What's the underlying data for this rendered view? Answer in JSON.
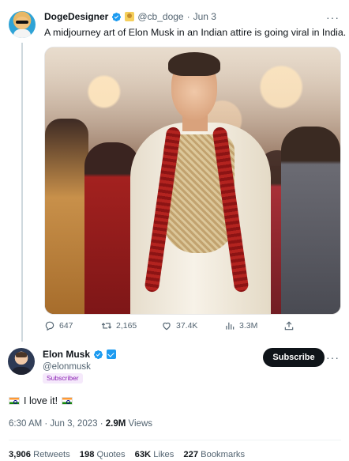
{
  "retweeted_tweet": {
    "author": {
      "display_name": "DogeDesigner",
      "handle": "@cb_doge",
      "verified": true,
      "affiliate_badge": "doge-badge"
    },
    "date": "Jun 3",
    "separator": "·",
    "more": "···",
    "text": "A midjourney art of Elon Musk in an Indian attire is going viral in India.",
    "text_emoji": "india-flag",
    "image_alt": "Elon Musk in Indian wedding attire",
    "actions": {
      "replies": "647",
      "retweets": "2,165",
      "likes": "37.4K",
      "views": "3.3M"
    }
  },
  "main_tweet": {
    "author": {
      "display_name": "Elon Musk",
      "handle": "@elonmusk",
      "verified": true,
      "label": "Subscriber"
    },
    "subscribe_label": "Subscribe",
    "more": "···",
    "text": "I love it!",
    "time": "6:30 AM · Jun 3, 2023 ·",
    "views_count": "2.9M",
    "views_label": "Views",
    "stats": {
      "retweets_count": "3,906",
      "retweets_label": "Retweets",
      "quotes_count": "198",
      "quotes_label": "Quotes",
      "likes_count": "63K",
      "likes_label": "Likes",
      "bookmarks_count": "227",
      "bookmarks_label": "Bookmarks"
    }
  },
  "colors": {
    "text": "#0f1419",
    "secondary": "#536471",
    "verified_blue": "#1d9bf0",
    "subscribe_bg": "#0f1419",
    "subscriber_pill_text": "#8a1fb3"
  }
}
